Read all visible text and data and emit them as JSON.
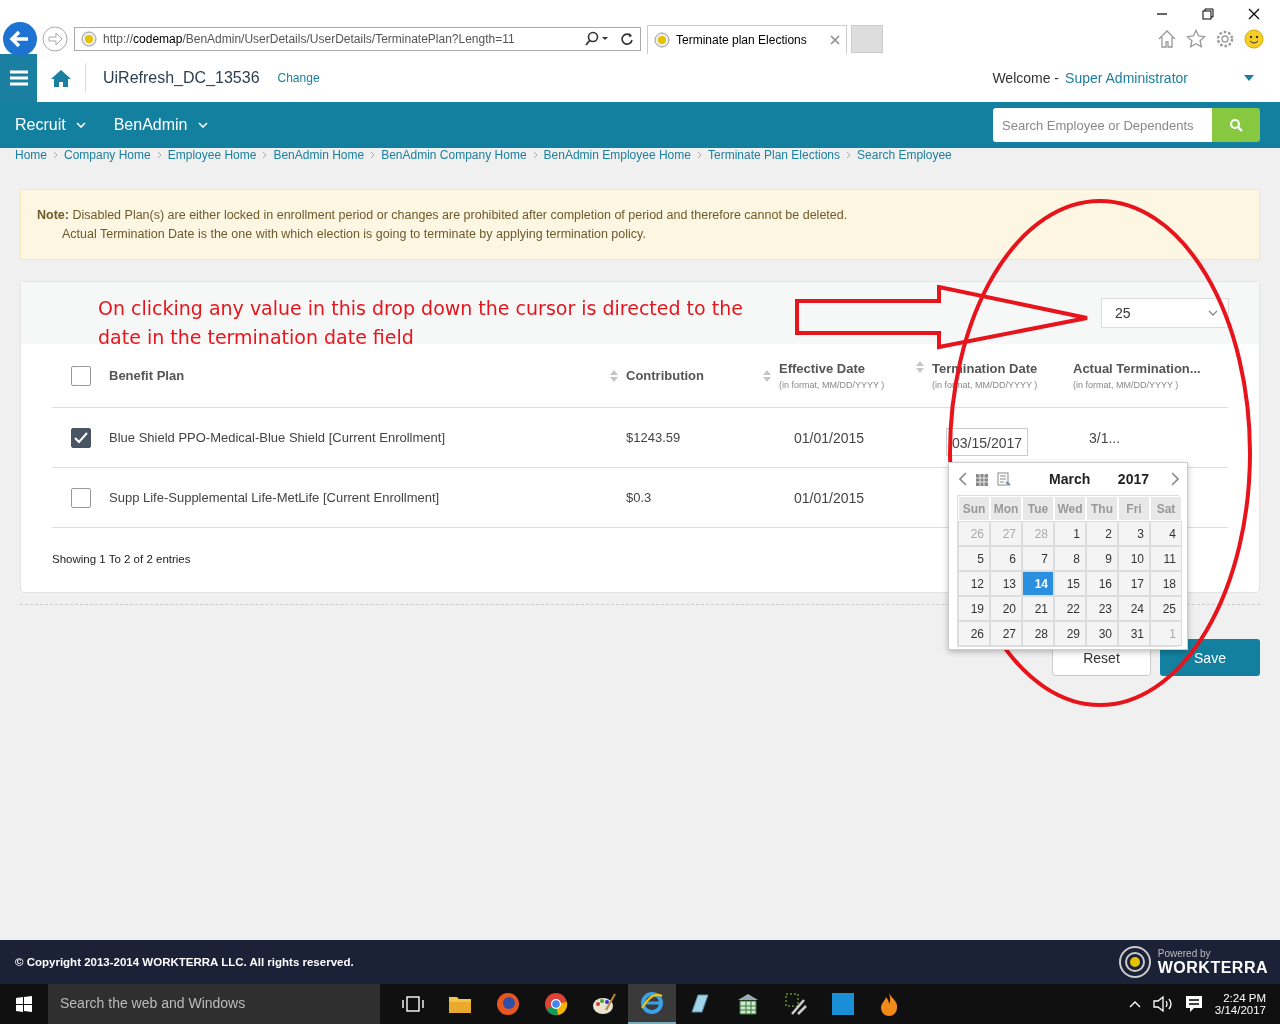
{
  "browser": {
    "address": {
      "scheme": "http://",
      "host": "codemap",
      "path": "/BenAdmin/UserDetails/UserDetails/TerminatePlan?Length=11"
    },
    "tab_title": "Terminate plan Elections"
  },
  "header": {
    "client": "UiRefresh_DC_13536",
    "change_link": "Change",
    "welcome": "Welcome -",
    "user": "Super Administrator"
  },
  "nav": {
    "menus": [
      {
        "label": "Recruit"
      },
      {
        "label": "BenAdmin"
      }
    ],
    "search": {
      "placeholder": "Search Employee or Dependents"
    }
  },
  "breadcrumb": [
    "Home",
    "Company Home",
    "Employee Home",
    "BenAdmin Home",
    "BenAdmin Company Home",
    "BenAdmin Employee Home",
    "Terminate Plan Elections",
    "Search Employee"
  ],
  "note": {
    "label": "Note:",
    "lines": [
      "Disabled Plan(s) are either locked in enrollment period or changes are prohibited after completion of period and therefore cannot be deleted.",
      "Actual Termination Date is the one with which election is going to terminate by applying termination policy."
    ]
  },
  "annotation": {
    "text": "On clicking any value in this drop down the cursor is directed to the date in the termination date field"
  },
  "page_size": "25",
  "table": {
    "select_all_checked": false,
    "columns": [
      {
        "title": "Benefit Plan",
        "sortable": true
      },
      {
        "title": "Contribution",
        "sortable": true
      },
      {
        "title": "Effective Date",
        "hint": "(in format, MM/DD/YYYY )",
        "sortable": true
      },
      {
        "title": "Termination Date",
        "hint": "(in format, MM/DD/YYYY )",
        "sortable": false
      },
      {
        "title": "Actual Termination...",
        "hint": "(in format, MM/DD/YYYY )",
        "sortable": false
      }
    ],
    "rows": [
      {
        "checked": true,
        "plan": "Blue Shield PPO-Medical-Blue Shield [Current Enrollment]",
        "contribution": "$1243.59",
        "effective": "01/01/2015",
        "termination": "03/15/2017",
        "actual": "3/1..."
      },
      {
        "checked": false,
        "plan": "Supp Life-Supplemental Life-MetLife [Current Enrollment]",
        "contribution": "$0.3",
        "effective": "01/01/2015"
      }
    ]
  },
  "entries_info": "Showing 1 To 2 of 2 entries",
  "buttons": [
    {
      "label": "Reset",
      "kind": "secondary"
    },
    {
      "label": "Save",
      "kind": "primary"
    }
  ],
  "calendar": {
    "month": "March",
    "year": "2017",
    "weekdays": [
      "Sun",
      "Mon",
      "Tue",
      "Wed",
      "Thu",
      "Fri",
      "Sat"
    ],
    "weeks": [
      [
        {
          "day": "26",
          "other_month": true,
          "selected": false
        },
        {
          "day": "27",
          "other_month": true,
          "selected": false
        },
        {
          "day": "28",
          "other_month": true,
          "selected": false
        },
        {
          "day": "1",
          "other_month": false,
          "selected": false
        },
        {
          "day": "2",
          "other_month": false,
          "selected": false
        },
        {
          "day": "3",
          "other_month": false,
          "selected": false
        },
        {
          "day": "4",
          "other_month": false,
          "selected": false
        }
      ],
      [
        {
          "day": "5",
          "other_month": false,
          "selected": false
        },
        {
          "day": "6",
          "other_month": false,
          "selected": false
        },
        {
          "day": "7",
          "other_month": false,
          "selected": false
        },
        {
          "day": "8",
          "other_month": false,
          "selected": false
        },
        {
          "day": "9",
          "other_month": false,
          "selected": false
        },
        {
          "day": "10",
          "other_month": false,
          "selected": false
        },
        {
          "day": "11",
          "other_month": false,
          "selected": false
        }
      ],
      [
        {
          "day": "12",
          "other_month": false,
          "selected": false
        },
        {
          "day": "13",
          "other_month": false,
          "selected": false
        },
        {
          "day": "14",
          "other_month": false,
          "selected": true
        },
        {
          "day": "15",
          "other_month": false,
          "selected": false
        },
        {
          "day": "16",
          "other_month": false,
          "selected": false
        },
        {
          "day": "17",
          "other_month": false,
          "selected": false
        },
        {
          "day": "18",
          "other_month": false,
          "selected": false
        }
      ],
      [
        {
          "day": "19",
          "other_month": false,
          "selected": false
        },
        {
          "day": "20",
          "other_month": false,
          "selected": false
        },
        {
          "day": "21",
          "other_month": false,
          "selected": false
        },
        {
          "day": "22",
          "other_month": false,
          "selected": false
        },
        {
          "day": "23",
          "other_month": false,
          "selected": false
        },
        {
          "day": "24",
          "other_month": false,
          "selected": false
        },
        {
          "day": "25",
          "other_month": false,
          "selected": false
        }
      ],
      [
        {
          "day": "26",
          "other_month": false,
          "selected": false
        },
        {
          "day": "27",
          "other_month": false,
          "selected": false
        },
        {
          "day": "28",
          "other_month": false,
          "selected": false
        },
        {
          "day": "29",
          "other_month": false,
          "selected": false
        },
        {
          "day": "30",
          "other_month": false,
          "selected": false
        },
        {
          "day": "31",
          "other_month": false,
          "selected": false
        },
        {
          "day": "1",
          "other_month": true,
          "selected": false
        }
      ]
    ]
  },
  "footer": {
    "copyright": "© Copyright 2013-2014 WORKTERRA LLC. All rights reserved.",
    "powered_by": "Powered by",
    "brand": "WORKTERRA"
  },
  "taskbar": {
    "search_placeholder": "Search the web and Windows",
    "time": "2:24 PM",
    "date": "3/14/2017"
  }
}
